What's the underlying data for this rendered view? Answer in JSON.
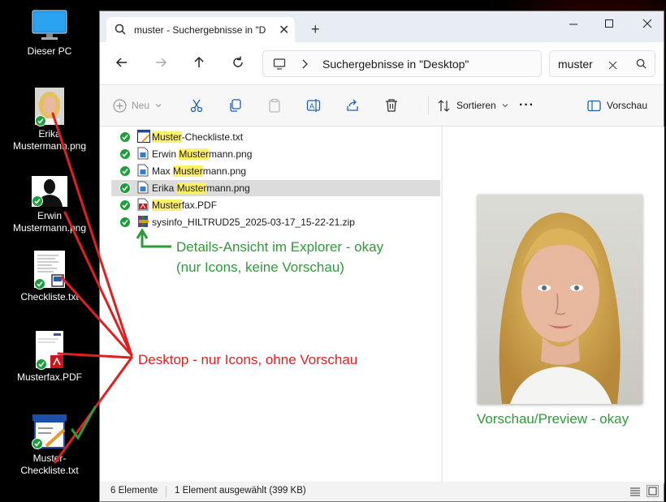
{
  "desktop": {
    "icons": [
      {
        "label_line1": "Dieser PC",
        "label_line2": ""
      },
      {
        "label_line1": "Erika",
        "label_line2": "Mustermann.png"
      },
      {
        "label_line1": "Erwin",
        "label_line2": "Mustermann.png"
      },
      {
        "label_line1": "Checkliste.txt",
        "label_line2": ""
      },
      {
        "label_line1": "Musterfax.PDF",
        "label_line2": ""
      },
      {
        "label_line1": "Muster-Checkliste.txt",
        "label_line2": ""
      }
    ]
  },
  "window": {
    "tab_title": "muster - Suchergebnisse in \"D",
    "tab_close": "✕",
    "new_tab": "+",
    "address": "Suchergebnisse in \"Desktop\"",
    "search_value": "muster",
    "toolbar": {
      "new_label": "Neu",
      "sort_label": "Sortieren",
      "more_label": "···",
      "preview_label": "Vorschau"
    },
    "files": [
      {
        "pre": "",
        "hl": "Muster",
        "post": "-Checkliste.txt",
        "icon": "txt-icon"
      },
      {
        "pre": "Erwin ",
        "hl": "Muster",
        "post": "mann.png",
        "icon": "png-icon"
      },
      {
        "pre": "Max ",
        "hl": "Muster",
        "post": "mann.png",
        "icon": "png-icon"
      },
      {
        "pre": "Erika ",
        "hl": "Muster",
        "post": "mann.png",
        "icon": "png-icon",
        "selected": true
      },
      {
        "pre": "",
        "hl": "Muster",
        "post": "fax.PDF",
        "icon": "pdf-icon"
      },
      {
        "pre": "sysinfo_HILTRUD25_2025-03-17_15-22-21.zip",
        "hl": "",
        "post": "",
        "icon": "zip-icon"
      }
    ],
    "status": {
      "count": "6 Elemente",
      "selection": "1 Element ausgewählt (399 KB)"
    }
  },
  "annotations": {
    "details_line1": "Details-Ansicht im Explorer - okay",
    "details_line2": "(nur Icons, keine Vorschau)",
    "desktop": "Desktop - nur Icons, ohne Vorschau",
    "preview": "Vorschau/Preview - okay"
  },
  "colors": {
    "annotation_green": "#2e9a3a",
    "annotation_red": "#e02020",
    "search_highlight": "#fff06a",
    "sync_check": "#1e9e3a"
  }
}
